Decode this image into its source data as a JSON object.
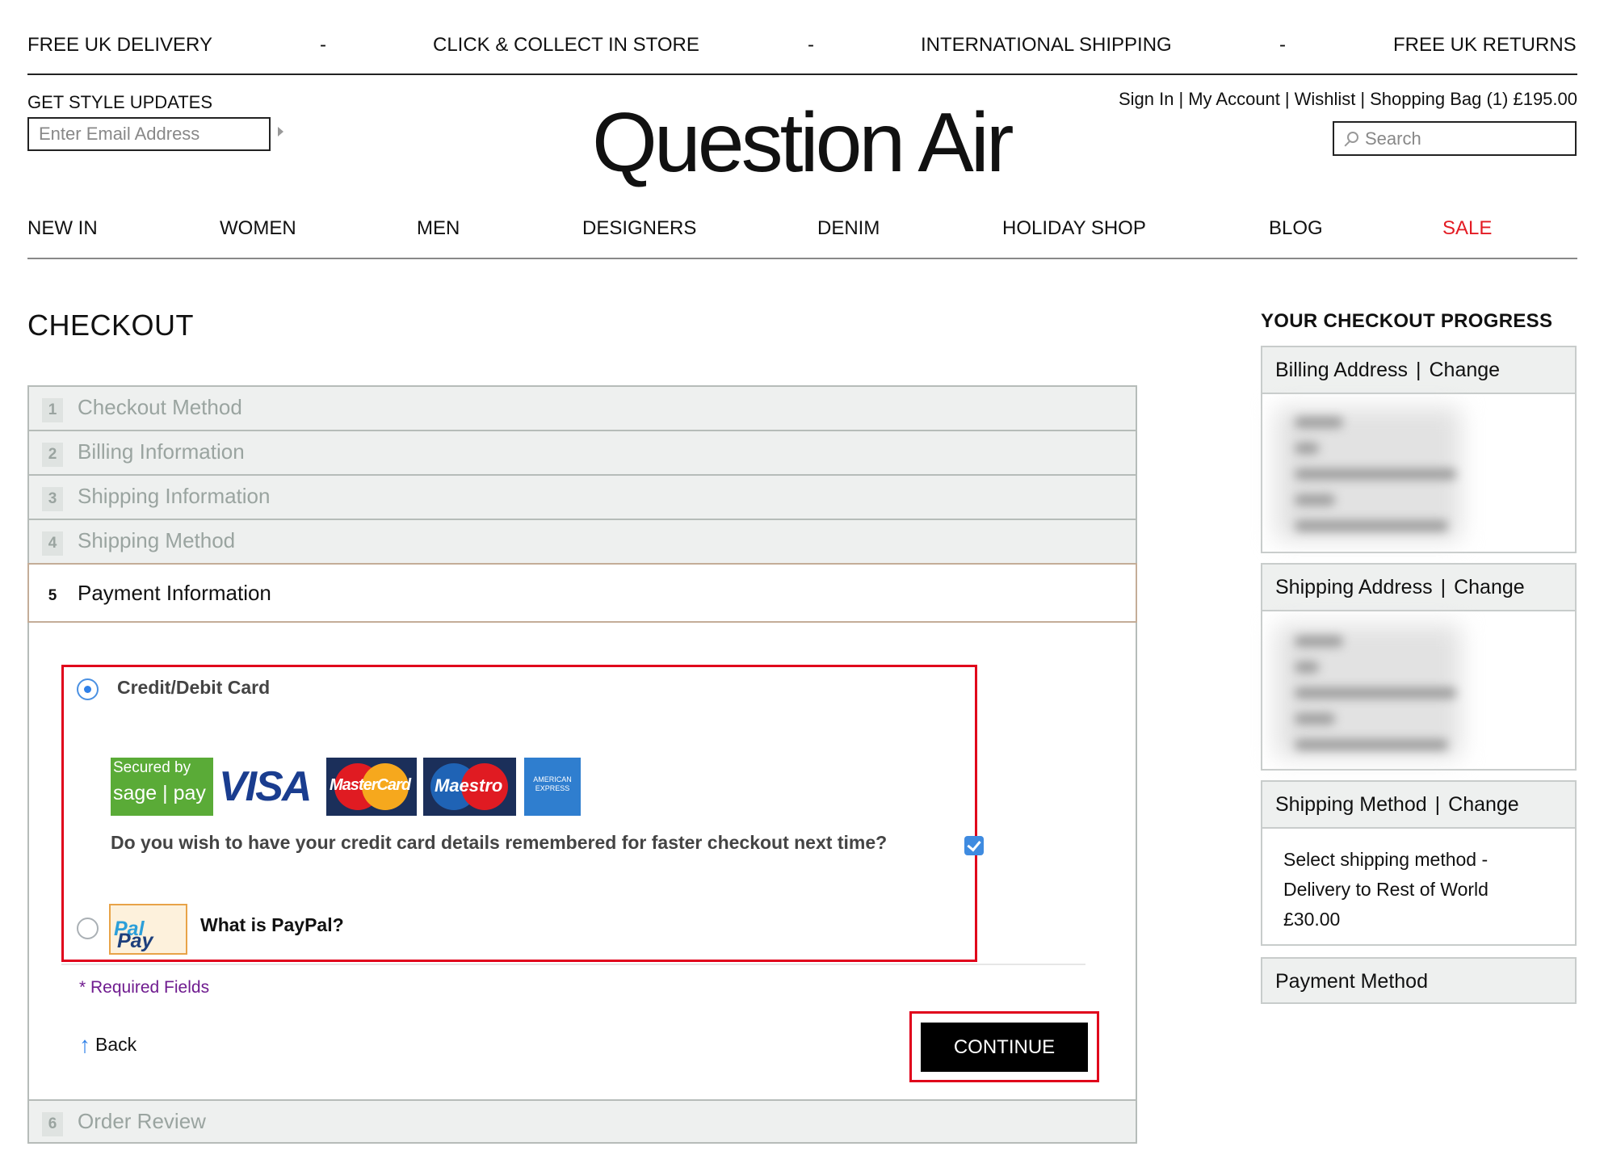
{
  "promo": {
    "delivery": "FREE UK DELIVERY",
    "collect": "CLICK & COLLECT IN STORE",
    "shipping": "INTERNATIONAL SHIPPING",
    "returns": "FREE UK RETURNS",
    "separator": "-"
  },
  "style_updates": {
    "label": "GET STYLE UPDATES",
    "placeholder": "Enter Email Address"
  },
  "brand": {
    "logo": "Question Air"
  },
  "account": {
    "sign_in": "Sign In",
    "my_account": "My Account",
    "wishlist": "Wishlist",
    "bag": "Shopping Bag (1) £195.00",
    "separator": "|"
  },
  "search": {
    "placeholder": "Search"
  },
  "nav": {
    "new_in": "NEW IN",
    "women": "WOMEN",
    "men": "MEN",
    "designers": "DESIGNERS",
    "denim": "DENIM",
    "holiday": "HOLIDAY SHOP",
    "blog": "BLOG",
    "sale": "SALE",
    "sale_color": "#e31b23"
  },
  "checkout": {
    "title": "CHECKOUT",
    "steps": [
      {
        "num": "1",
        "label": "Checkout Method"
      },
      {
        "num": "2",
        "label": "Billing Information"
      },
      {
        "num": "3",
        "label": "Shipping Information"
      },
      {
        "num": "4",
        "label": "Shipping Method"
      },
      {
        "num": "5",
        "label": "Payment Information"
      },
      {
        "num": "6",
        "label": "Order Review"
      }
    ],
    "payment": {
      "card_label": "Credit/Debit Card",
      "card_selected": true,
      "sage_line1": "Secured by",
      "sage_line2": "sage | pay",
      "visa": "VISA",
      "mastercard": "MasterCard",
      "maestro": "Maestro",
      "amex": "AMERICAN EXPRESS",
      "remember": "Do you wish to have your credit card details remembered for faster checkout next time?",
      "remember_checked": true,
      "paypal_logo_pay": "Pay",
      "paypal_logo_pal": "Pal",
      "paypal_label": "What is PayPal?"
    },
    "required": "* Required Fields",
    "back": "Back",
    "continue": "CONTINUE"
  },
  "progress": {
    "title": "YOUR CHECKOUT PROGRESS",
    "change": "Change",
    "separator": "|",
    "billing": "Billing Address",
    "shipping_address": "Shipping Address",
    "shipping_method": "Shipping Method",
    "shipping_method_details": "Select shipping method -\nDelivery to Rest of World\n£30.00",
    "payment_method": "Payment Method"
  },
  "colors": {
    "highlight": "#e0001b",
    "accent_blue": "#2f80e8",
    "required": "#6f1b8f"
  }
}
